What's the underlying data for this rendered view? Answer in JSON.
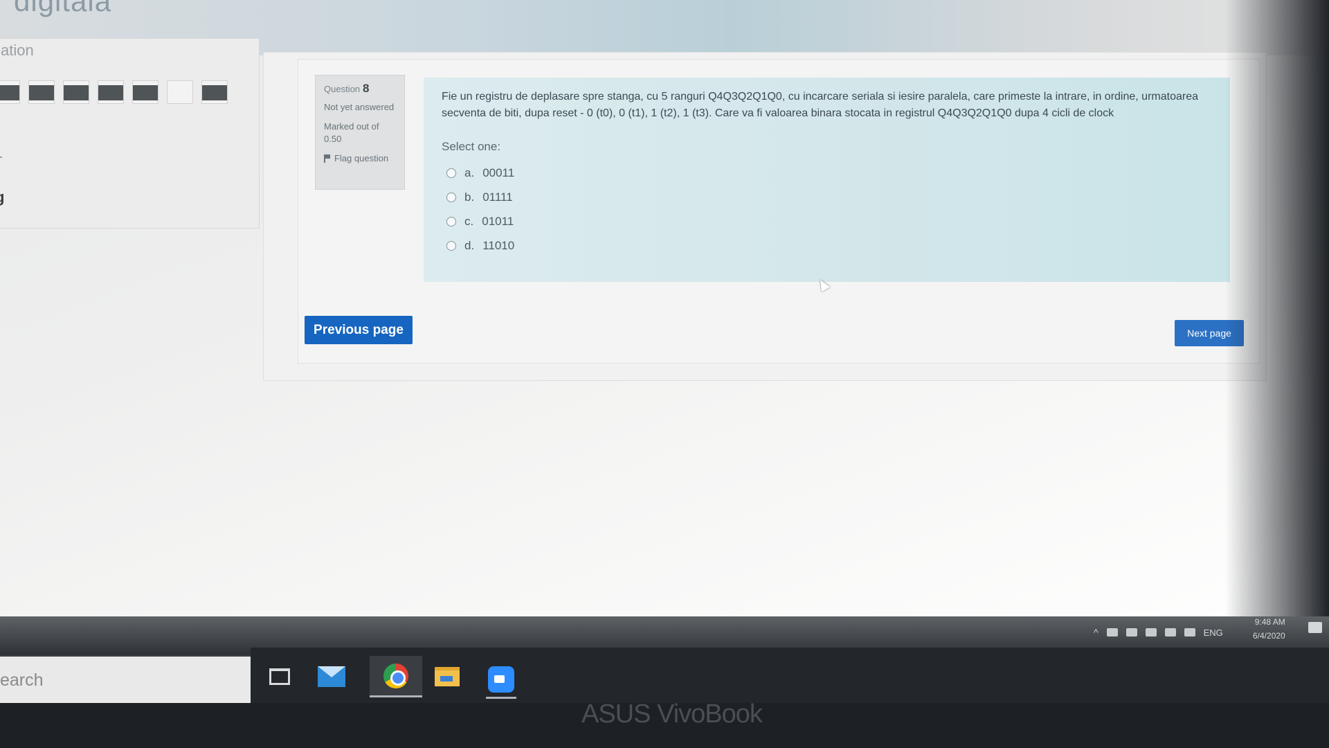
{
  "header": {
    "course_title": "digitala"
  },
  "quiz_navigation": {
    "title": "ation",
    "side_letter": "g"
  },
  "question": {
    "label": "Question",
    "number": "8",
    "status": "Not yet answered",
    "marked": "Marked out of 0.50",
    "flag_label": "Flag question",
    "text": "Fie un registru de deplasare spre stanga, cu 5 ranguri Q4Q3Q2Q1Q0, cu incarcare seriala si iesire paralela, care primeste la intrare, in ordine, urmatoarea secventa de biti, dupa reset - 0 (t0), 0 (t1), 1 (t2), 1 (t3). Care va fi valoarea binara stocata in registrul Q4Q3Q2Q1Q0 dupa 4 cicli de clock",
    "select_one": "Select one:",
    "options": [
      {
        "letter": "a.",
        "value": "00011"
      },
      {
        "letter": "b.",
        "value": "01111"
      },
      {
        "letter": "c.",
        "value": "01011"
      },
      {
        "letter": "d.",
        "value": "11010"
      }
    ]
  },
  "buttons": {
    "previous": "Previous page",
    "next": "Next page"
  },
  "taskbar": {
    "search_placeholder": "earch",
    "language": "ENG",
    "time": "9:48 AM",
    "date": "6/4/2020"
  },
  "device": {
    "brand": "ASUS VivoBook"
  },
  "colors": {
    "primary_button": "#1665c0",
    "question_bg": "#d2e6ea"
  }
}
